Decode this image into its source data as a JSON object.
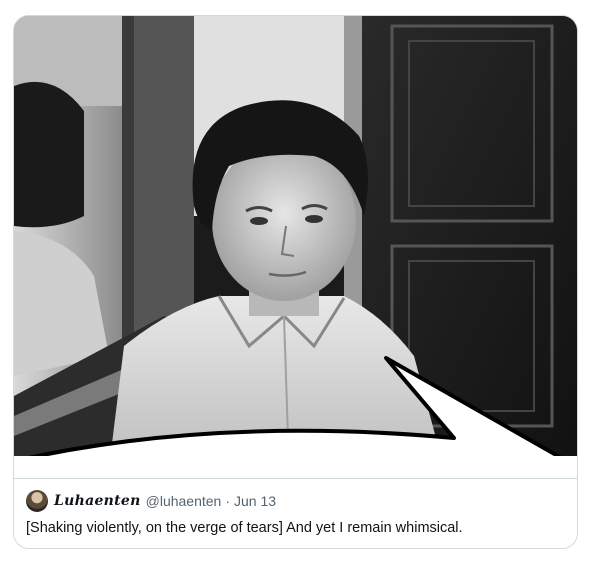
{
  "quote_tweet": {
    "display_name": "Luhaenten",
    "handle": "@luhaenten",
    "separator": "·",
    "date": "Jun 13",
    "text": "[Shaking violently, on the verge of tears] And yet I remain whimsical.",
    "avatar_icon": "user-avatar"
  },
  "colors": {
    "border": "#cfd9de",
    "muted_text": "#536471",
    "main_text": "#0f1419"
  }
}
